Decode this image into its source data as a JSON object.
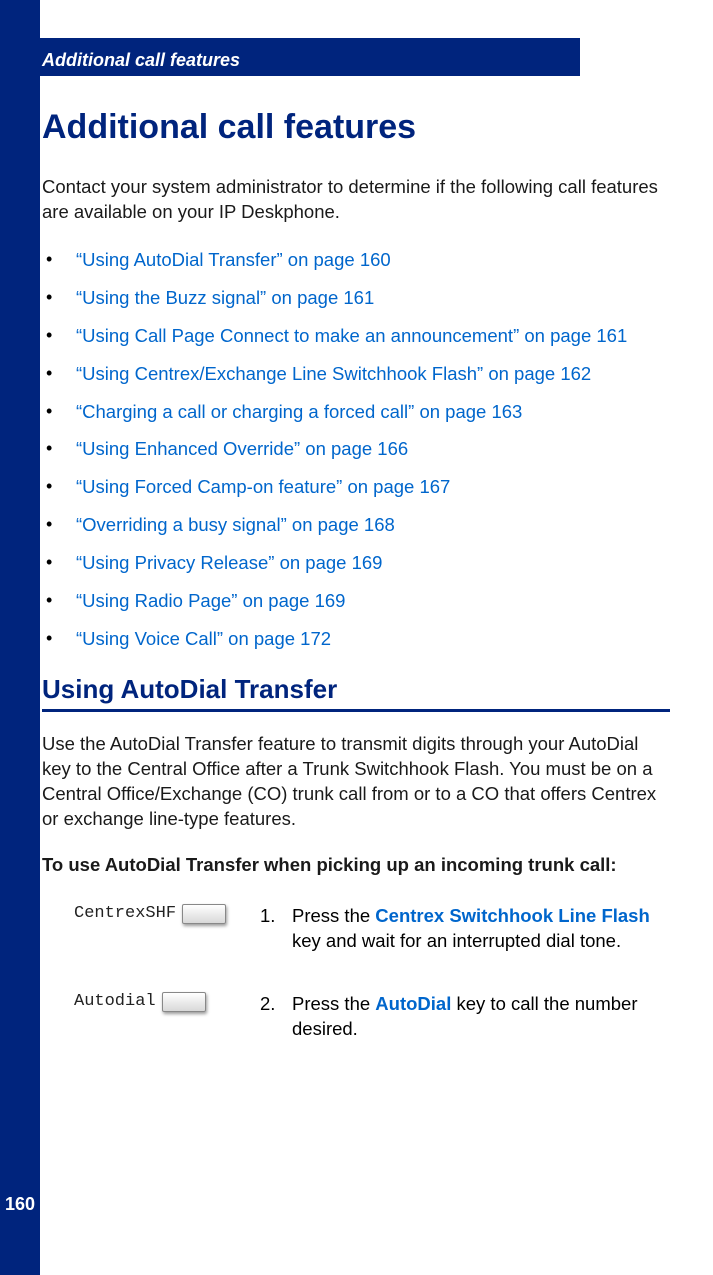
{
  "page_number": "160",
  "header_bar": "Additional call features",
  "main_title": "Additional call features",
  "intro": "Contact your system administrator to determine if the following call features are available on your IP Deskphone.",
  "links": [
    "“Using AutoDial Transfer” on page 160",
    "“Using the Buzz signal” on page 161",
    "“Using Call Page Connect to make an announcement” on page 161",
    "“Using Centrex/Exchange Line Switchhook Flash” on page 162",
    "“Charging a call or charging a forced call” on page 163",
    "“Using Enhanced Override” on page 166",
    "“Using Forced Camp-on feature” on page 167",
    "“Overriding a busy signal” on page 168",
    "“Using Privacy Release” on page 169",
    "“Using Radio Page” on page 169",
    "“Using Voice Call” on page 172"
  ],
  "section_title": "Using AutoDial Transfer",
  "section_body": "Use the AutoDial Transfer feature to transmit digits through your AutoDial key to the Central Office after a Trunk Switchhook Flash. You must be on a Central Office/Exchange (CO) trunk call from or to a CO that offers Centrex or exchange line-type features.",
  "sub_instr": "To use AutoDial Transfer when picking up an incoming trunk call:",
  "steps": [
    {
      "key_label": "CentrexSHF",
      "num": "1.",
      "text_pre": "Press the ",
      "emph": "Centrex Switchhook Line Flash",
      "text_post": " key and wait for an interrupted dial tone."
    },
    {
      "key_label": "Autodial",
      "num": "2.",
      "text_pre": "Press the ",
      "emph": "AutoDial",
      "text_post": " key to call the number desired."
    }
  ]
}
